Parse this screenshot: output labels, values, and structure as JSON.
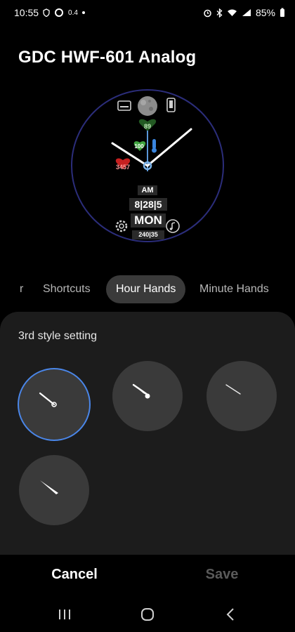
{
  "status_bar": {
    "time": "10:55",
    "extra": "0.4",
    "battery": "85%",
    "icons": [
      "alarm-icon",
      "bluetooth-icon",
      "wifi-icon",
      "signal-icon",
      "battery-icon"
    ]
  },
  "title": "GDC HWF-601 Analog",
  "watch_face": {
    "heart_rate": "89",
    "battery": "100",
    "steps": "3457",
    "am_pm": "AM",
    "date": "8|28|5",
    "day": "MON",
    "numbers": "240|35",
    "colors": {
      "ring": "#2b2d7a",
      "hands": "#ffffff",
      "center": "#7cb3e8"
    }
  },
  "tabs": [
    {
      "label": "r"
    },
    {
      "label": "Shortcuts"
    },
    {
      "label": "Hour Hands",
      "active": true
    },
    {
      "label": "Minute Hands"
    }
  ],
  "panel": {
    "title": "3rd style setting",
    "options": [
      {
        "name": "style-1",
        "selected": true
      },
      {
        "name": "style-2",
        "selected": false
      },
      {
        "name": "style-3",
        "selected": false
      },
      {
        "name": "style-4",
        "selected": false
      }
    ]
  },
  "actions": {
    "cancel": "Cancel",
    "save": "Save"
  },
  "nav": [
    "recent-apps-icon",
    "home-icon",
    "back-icon"
  ],
  "colors": {
    "accent": "#4a86e8",
    "panel_bg": "#1c1c1c",
    "active_tab_bg": "#3a3a3a",
    "disabled_text": "#5a5a5a"
  }
}
